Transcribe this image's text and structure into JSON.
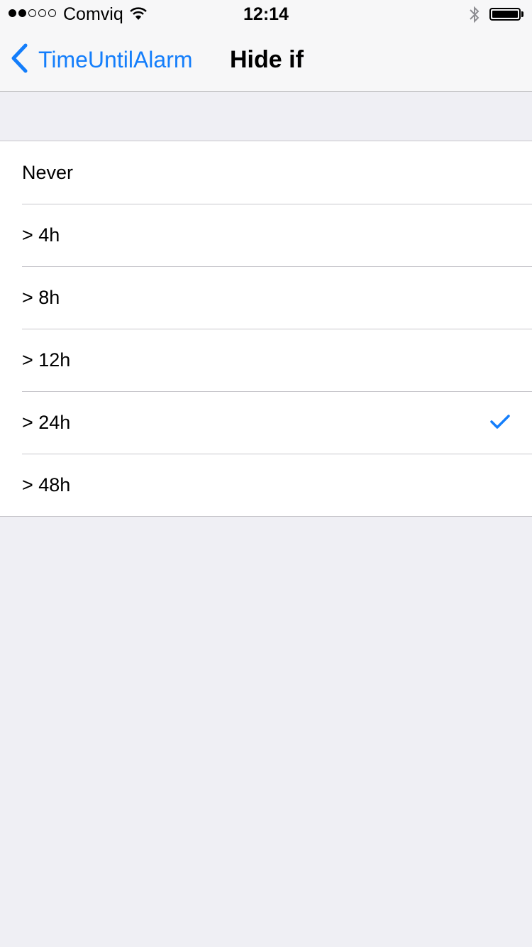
{
  "status_bar": {
    "signal": "signal-dots-2-of-5",
    "carrier": "Comviq",
    "wifi_icon": "wifi-icon",
    "time": "12:14",
    "bluetooth_icon": "bluetooth-icon",
    "battery_icon": "battery-full-icon"
  },
  "nav": {
    "back_icon": "chevron-left-icon",
    "back_label": "TimeUntilAlarm",
    "title": "Hide if"
  },
  "options": [
    {
      "label": "Never",
      "selected": false
    },
    {
      "label": "> 4h",
      "selected": false
    },
    {
      "label": "> 8h",
      "selected": false
    },
    {
      "label": "> 12h",
      "selected": false
    },
    {
      "label": "> 24h",
      "selected": true
    },
    {
      "label": "> 48h",
      "selected": false
    }
  ],
  "checkmark_icon": "checkmark-icon",
  "colors": {
    "accent": "#147efb",
    "background": "#efeff4",
    "bar_background": "#f7f7f8",
    "separator": "#c8c7cc"
  }
}
